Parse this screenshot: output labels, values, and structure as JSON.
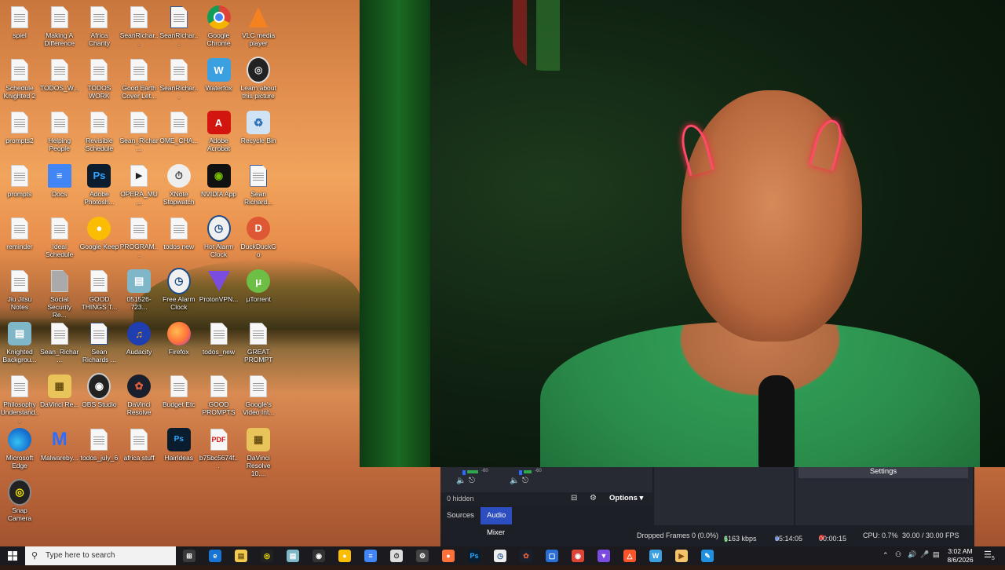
{
  "desktop": {
    "icons": [
      {
        "label": "spiel",
        "icon": "document-icon"
      },
      {
        "label": "Making A Difference",
        "icon": "document-icon"
      },
      {
        "label": "Africa Charity",
        "icon": "document-icon"
      },
      {
        "label": "SeanRichar...",
        "icon": "document-icon"
      },
      {
        "label": "SeanRichar...",
        "icon": "word-document-icon"
      },
      {
        "label": "Google Chrome",
        "icon": "chrome-icon"
      },
      {
        "label": "VLC media player",
        "icon": "vlc-icon"
      },
      {
        "label": "Schedule Knighted 2",
        "icon": "document-icon"
      },
      {
        "label": "TODOS_W...",
        "icon": "document-icon"
      },
      {
        "label": "TODOS WORK",
        "icon": "document-icon"
      },
      {
        "label": "Good Earth Cover Let...",
        "icon": "document-icon"
      },
      {
        "label": "SeanRichar...",
        "icon": "document-icon"
      },
      {
        "label": "Waterfox",
        "icon": "waterfox-icon"
      },
      {
        "label": "Learn about this picture",
        "icon": "camera-icon"
      },
      {
        "label": "prompts2",
        "icon": "document-icon"
      },
      {
        "label": "Helping People",
        "icon": "document-icon"
      },
      {
        "label": "Revisible Schedule",
        "icon": "document-icon"
      },
      {
        "label": "Sean_Richar...",
        "icon": "document-icon"
      },
      {
        "label": "OME_CHA...",
        "icon": "document-icon"
      },
      {
        "label": "Adobe Acrobat",
        "icon": "acrobat-icon"
      },
      {
        "label": "Recycle Bin",
        "icon": "recycle-bin-icon"
      },
      {
        "label": "prompts",
        "icon": "document-icon"
      },
      {
        "label": "Docs",
        "icon": "google-docs-icon"
      },
      {
        "label": "Adobe Photosh...",
        "icon": "photoshop-icon"
      },
      {
        "label": "OPERA_MU...",
        "icon": "media-file-icon"
      },
      {
        "label": "XNote Stopwatch",
        "icon": "stopwatch-icon"
      },
      {
        "label": "NVIDIA App",
        "icon": "nvidia-icon"
      },
      {
        "label": "Sean Richard...",
        "icon": "word-document-icon"
      },
      {
        "label": "reminder",
        "icon": "document-icon"
      },
      {
        "label": "Ideal Schedule",
        "icon": "document-icon"
      },
      {
        "label": "Google Keep",
        "icon": "google-keep-icon"
      },
      {
        "label": "PROGRAM...",
        "icon": "document-icon"
      },
      {
        "label": "todos new",
        "icon": "document-icon"
      },
      {
        "label": "Hot Alarm Clock",
        "icon": "alarm-clock-icon"
      },
      {
        "label": "DuckDuckGo",
        "icon": "duckduckgo-icon"
      },
      {
        "label": "Jiu Jitsu Notes",
        "icon": "document-icon"
      },
      {
        "label": "Social Security Re...",
        "icon": "scan-document-icon"
      },
      {
        "label": "GOOD THINGS T...",
        "icon": "document-icon"
      },
      {
        "label": "051526-723...",
        "icon": "image-file-icon"
      },
      {
        "label": "Free Alarm Clock",
        "icon": "alarm-clock-icon"
      },
      {
        "label": "ProtonVPN...",
        "icon": "protonvpn-icon"
      },
      {
        "label": "μTorrent",
        "icon": "utorrent-icon"
      },
      {
        "label": "Knighted Backgrou...",
        "icon": "image-file-icon"
      },
      {
        "label": "Sean_Richar...",
        "icon": "document-icon"
      },
      {
        "label": "Sean Richards ...",
        "icon": "word-document-icon"
      },
      {
        "label": "Audacity",
        "icon": "audacity-icon"
      },
      {
        "label": "Firefox",
        "icon": "firefox-icon"
      },
      {
        "label": "todos_new",
        "icon": "document-icon"
      },
      {
        "label": "GREAT PROMPT",
        "icon": "document-icon"
      },
      {
        "label": "Philosophy Understand...",
        "icon": "document-icon"
      },
      {
        "label": "DaVinci Re...",
        "icon": "zip-folder-icon"
      },
      {
        "label": "OBS Studio",
        "icon": "obs-icon"
      },
      {
        "label": "DaVinci Resolve",
        "icon": "davinci-icon"
      },
      {
        "label": "Budget Etc",
        "icon": "document-icon"
      },
      {
        "label": "GOOD PROMPTS",
        "icon": "document-icon"
      },
      {
        "label": "Google's Video Int...",
        "icon": "document-icon"
      },
      {
        "label": "Microsoft Edge",
        "icon": "edge-icon"
      },
      {
        "label": "Malwareby...",
        "icon": "malwarebytes-icon"
      },
      {
        "label": "todos_july_6",
        "icon": "document-icon"
      },
      {
        "label": "africa stuff",
        "icon": "document-icon"
      },
      {
        "label": "HairIdeas",
        "icon": "psd-file-icon"
      },
      {
        "label": "b75bc5674f...",
        "icon": "pdf-file-icon"
      },
      {
        "label": "DaVinci Resolve 10....",
        "icon": "zip-folder-icon"
      },
      {
        "label": "Snap Camera",
        "icon": "snap-camera-icon"
      }
    ]
  },
  "obs": {
    "meter_a_label": "-60",
    "meter_b_label": "-60",
    "hidden_text": "0 hidden",
    "options_label": "Options",
    "tab_sources": "Sources",
    "tab_audio_mixer": "Audio Mixer",
    "settings_label": "Settings",
    "status": {
      "dropped_frames": "Dropped Frames 0 (0.0%)",
      "kbps": "6163 kbps",
      "rec_time": "05:14:05",
      "stream_time": "00:00:15",
      "cpu": "CPU: 0.7%",
      "fps": "30.00 / 30.00 FPS"
    }
  },
  "taskbar": {
    "search_placeholder": "Type here to search",
    "time": "3:02 AM",
    "date": "8/6/2026",
    "notification_count": "5"
  }
}
